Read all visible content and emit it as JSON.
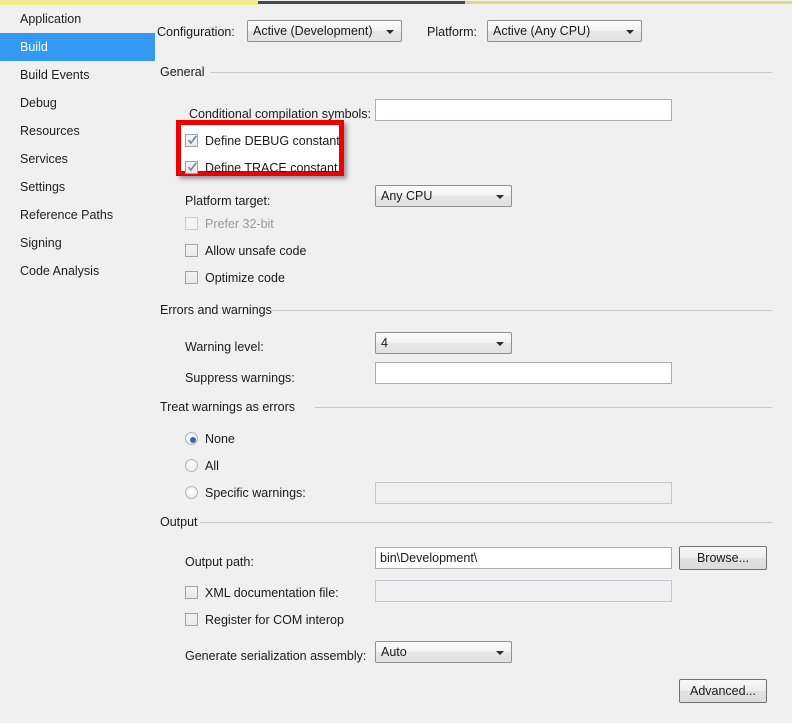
{
  "sidebar": {
    "items": [
      {
        "label": "Application",
        "selected": false
      },
      {
        "label": "Build",
        "selected": true
      },
      {
        "label": "Build Events",
        "selected": false
      },
      {
        "label": "Debug",
        "selected": false
      },
      {
        "label": "Resources",
        "selected": false
      },
      {
        "label": "Services",
        "selected": false
      },
      {
        "label": "Settings",
        "selected": false
      },
      {
        "label": "Reference Paths",
        "selected": false
      },
      {
        "label": "Signing",
        "selected": false
      },
      {
        "label": "Code Analysis",
        "selected": false
      }
    ]
  },
  "header": {
    "configuration_label": "Configuration:",
    "configuration_value": "Active (Development)",
    "platform_label": "Platform:",
    "platform_value": "Active (Any CPU)"
  },
  "general": {
    "title": "General",
    "conditional_symbols_label": "Conditional compilation symbols:",
    "conditional_symbols_value": "",
    "define_debug_label": "Define DEBUG constant",
    "define_debug_checked": true,
    "define_trace_label": "Define TRACE constant",
    "define_trace_checked": true,
    "platform_target_label": "Platform target:",
    "platform_target_value": "Any CPU",
    "prefer_32bit_label": "Prefer 32-bit",
    "prefer_32bit_checked": false,
    "allow_unsafe_label": "Allow unsafe code",
    "allow_unsafe_checked": false,
    "optimize_label": "Optimize code",
    "optimize_checked": false
  },
  "errors_warnings": {
    "title": "Errors and warnings",
    "warning_level_label": "Warning level:",
    "warning_level_value": "4",
    "suppress_warnings_label": "Suppress warnings:",
    "suppress_warnings_value": ""
  },
  "treat_warnings": {
    "title": "Treat warnings as errors",
    "none_label": "None",
    "all_label": "All",
    "specific_label": "Specific warnings:",
    "specific_value": "",
    "selected": "None"
  },
  "output": {
    "title": "Output",
    "output_path_label": "Output path:",
    "output_path_value": "bin\\Development\\",
    "browse_label": "Browse...",
    "xml_doc_label": "XML documentation file:",
    "xml_doc_checked": false,
    "xml_doc_value": "",
    "register_com_label": "Register for COM interop",
    "register_com_checked": false,
    "serialization_label": "Generate serialization assembly:",
    "serialization_value": "Auto"
  },
  "footer": {
    "advanced_label": "Advanced..."
  },
  "colors": {
    "selection_blue": "#3399f3",
    "annotation_red": "#ee0000",
    "panel_background": "#f0f0f0",
    "accent_yellow": "#f7e98e"
  }
}
